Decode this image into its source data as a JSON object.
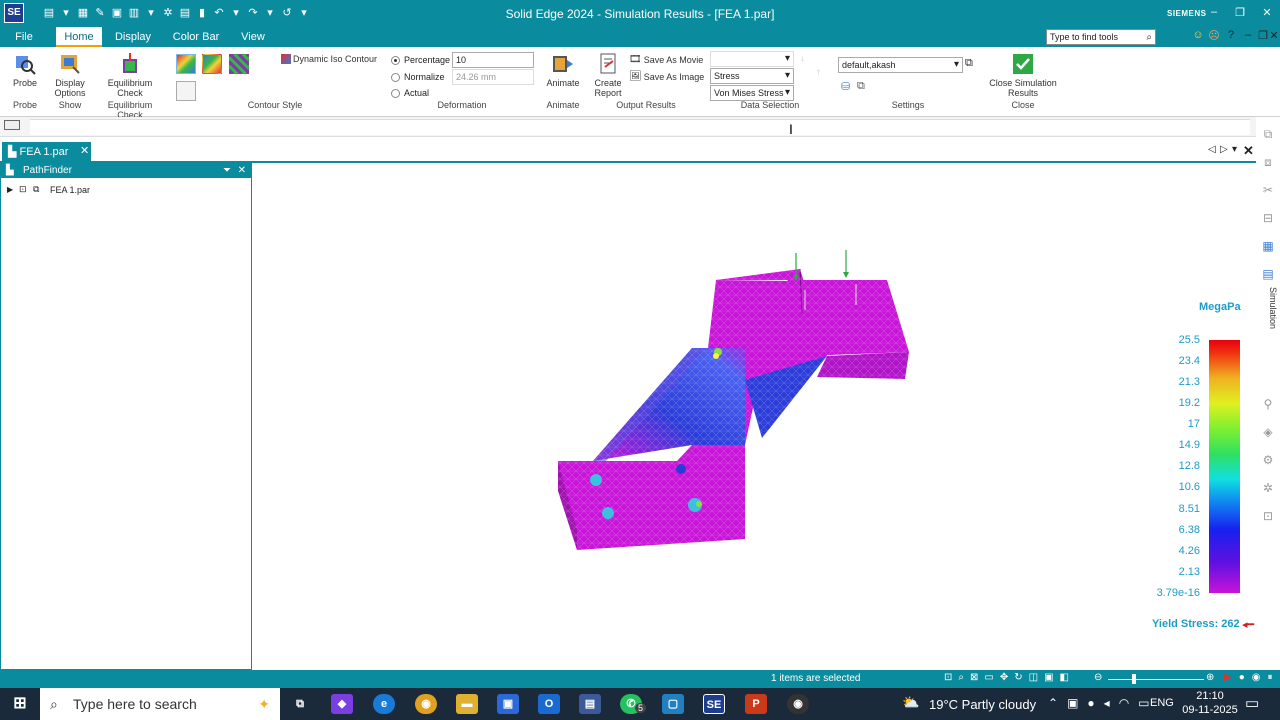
{
  "app": {
    "logo": "SE",
    "title": "Solid Edge 2024 - Simulation Results - [FEA 1.par]",
    "brand": "SIEMENS",
    "window_controls": [
      "–",
      "❐",
      "✕"
    ]
  },
  "menu": {
    "file": "File",
    "tabs": [
      "Home",
      "Display",
      "Color Bar",
      "View"
    ],
    "search_placeholder": "Type to find tools"
  },
  "ribbon": {
    "probe": "Probe",
    "display_options": [
      "Display",
      "Options"
    ],
    "equilibrium": [
      "Equilibrium",
      "Check"
    ],
    "dynamic_iso": "Dynamic Iso Contour",
    "deformation": {
      "percentage_label": "Percentage",
      "percentage_value": "10",
      "normalize_label": "Normalize",
      "normalize_value": "24.26 mm",
      "actual_label": "Actual"
    },
    "animate": "Animate",
    "create_report": [
      "Create",
      "Report"
    ],
    "save_movie": "Save As Movie",
    "save_image": "Save As Image",
    "data_selection": {
      "type": "Stress",
      "component": "Von Mises Stress"
    },
    "settings_value": "default,akash",
    "close_sim": [
      "Close Simulation",
      "Results"
    ],
    "groups": {
      "probe": "Probe",
      "show": "Show",
      "equilibrium": "Equilibrium Check",
      "contour": "Contour Style",
      "deformation": "Deformation",
      "animate": "Animate",
      "output": "Output Results",
      "data": "Data Selection",
      "settings": "Settings",
      "close": "Close"
    }
  },
  "document": {
    "tab": "FEA 1.par"
  },
  "pathfinder": {
    "title": "PathFinder",
    "item": "FEA 1.par"
  },
  "legend": {
    "unit": "MegaPa",
    "values": [
      "25.5",
      "23.4",
      "21.3",
      "19.2",
      "17",
      "14.9",
      "12.8",
      "10.6",
      "8.51",
      "6.38",
      "4.26",
      "2.13",
      "3.79e-16"
    ],
    "yield": "Yield Stress: 262"
  },
  "sidebar": {
    "label": "Simulation"
  },
  "status": {
    "selection": "1 items are selected"
  },
  "taskbar": {
    "search": "Type here to search",
    "weather": "19°C  Partly cloudy",
    "lang": "ENG",
    "time": "21:10",
    "date": "09-11-2025",
    "whatsapp_badge": "5"
  },
  "colors": {
    "accent": "#0a8c9e",
    "legend_text": "#1e9cc8",
    "yield_text": "#1e9cc8",
    "mesh_low": "#c814d8",
    "mesh_mid": "#2a3cd8"
  }
}
